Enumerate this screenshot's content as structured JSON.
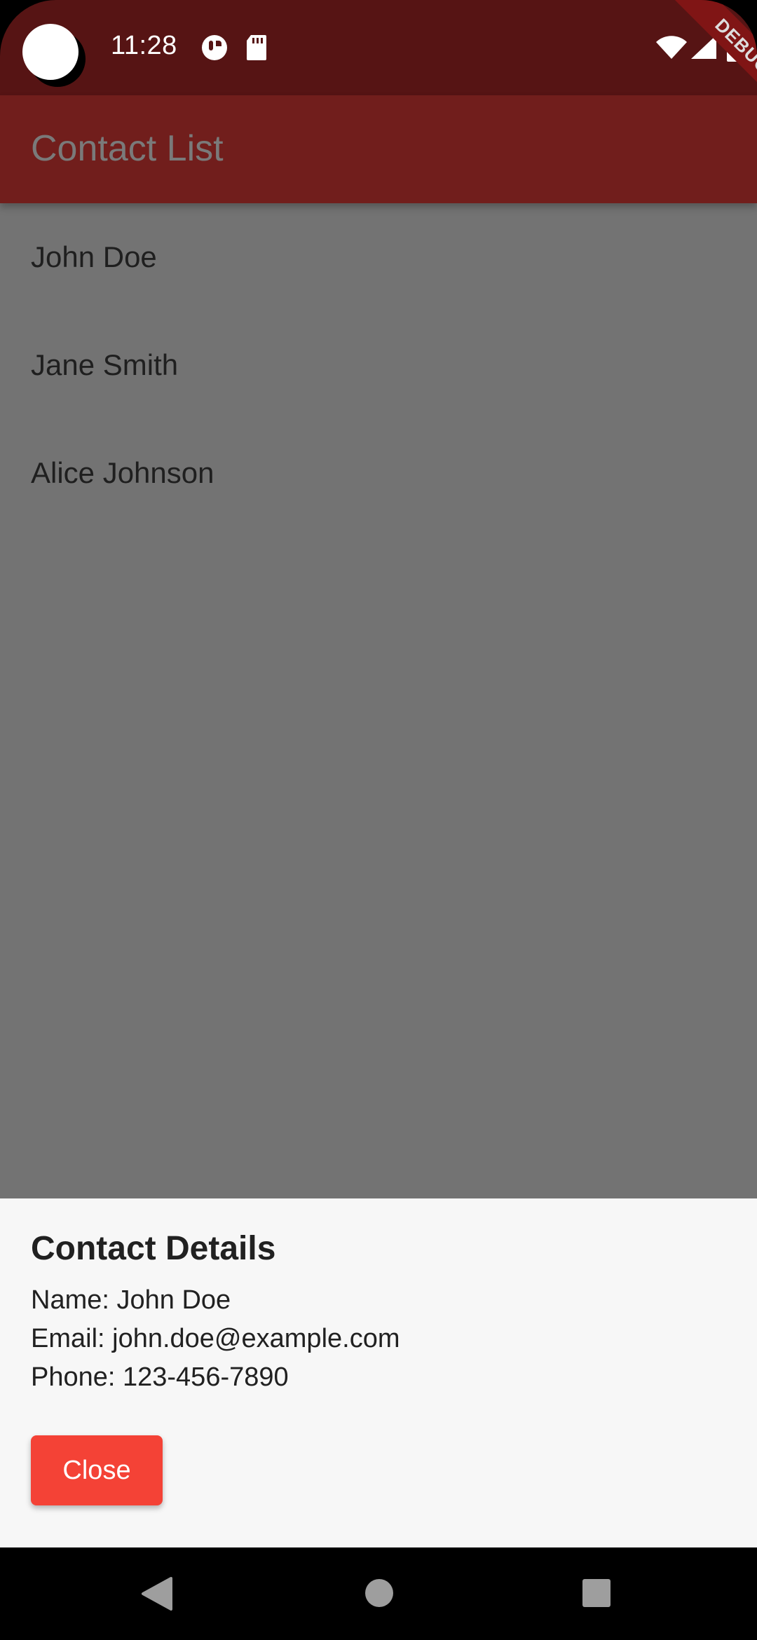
{
  "status_bar": {
    "time": "11:28",
    "icons": [
      "mystery-app-icon",
      "sd-card-icon",
      "wifi-icon",
      "signal-icon",
      "battery-icon"
    ]
  },
  "debug_banner": {
    "label": "DEBUG"
  },
  "app_bar": {
    "title": "Contact List"
  },
  "contacts": [
    {
      "name": "John Doe"
    },
    {
      "name": "Jane Smith"
    },
    {
      "name": "Alice Johnson"
    }
  ],
  "details_sheet": {
    "title": "Contact Details",
    "name_line": "Name: John Doe",
    "email_line": "Email: john.doe@example.com",
    "phone_line": "Phone: 123-456-7890",
    "close_label": "Close"
  },
  "nav_bar": {
    "icons": [
      "back-icon",
      "home-icon",
      "recents-icon"
    ]
  },
  "colors": {
    "status_bar": "#561414",
    "app_bar": "#711e1c",
    "scrim": "#737373",
    "sheet": "#f7f7f7",
    "close_button": "#f44236"
  }
}
